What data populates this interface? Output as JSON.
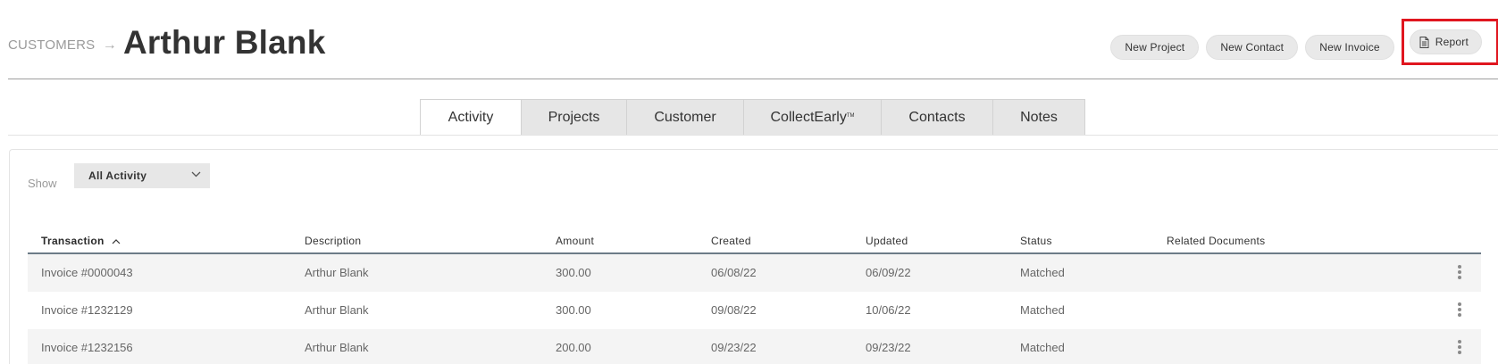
{
  "header": {
    "breadcrumb": "CUSTOMERS",
    "breadcrumb_arrow": "→",
    "title": "Arthur Blank",
    "actions": {
      "new_project": "New Project",
      "new_contact": "New Contact",
      "new_invoice": "New Invoice",
      "report": "Report"
    },
    "highlight_color": "#e0161f"
  },
  "tabs": [
    {
      "label": "Activity",
      "active": true
    },
    {
      "label": "Projects",
      "active": false
    },
    {
      "label": "Customer",
      "active": false
    },
    {
      "label": "CollectEarly",
      "trademark": "TM",
      "active": false
    },
    {
      "label": "Contacts",
      "active": false
    },
    {
      "label": "Notes",
      "active": false
    }
  ],
  "filter": {
    "label": "Show",
    "selected": "All Activity"
  },
  "table": {
    "columns": {
      "transaction": "Transaction",
      "description": "Description",
      "amount": "Amount",
      "created": "Created",
      "updated": "Updated",
      "status": "Status",
      "related": "Related Documents"
    },
    "sort_indicator": "ascending",
    "rows": [
      {
        "transaction": "Invoice #0000043",
        "description": "Arthur Blank",
        "amount": "300.00",
        "created": "06/08/22",
        "updated": "06/09/22",
        "status": "Matched",
        "related": ""
      },
      {
        "transaction": "Invoice #1232129",
        "description": "Arthur Blank",
        "amount": "300.00",
        "created": "09/08/22",
        "updated": "10/06/22",
        "status": "Matched",
        "related": ""
      },
      {
        "transaction": "Invoice #1232156",
        "description": "Arthur Blank",
        "amount": "200.00",
        "created": "09/23/22",
        "updated": "09/23/22",
        "status": "Matched",
        "related": ""
      }
    ]
  }
}
